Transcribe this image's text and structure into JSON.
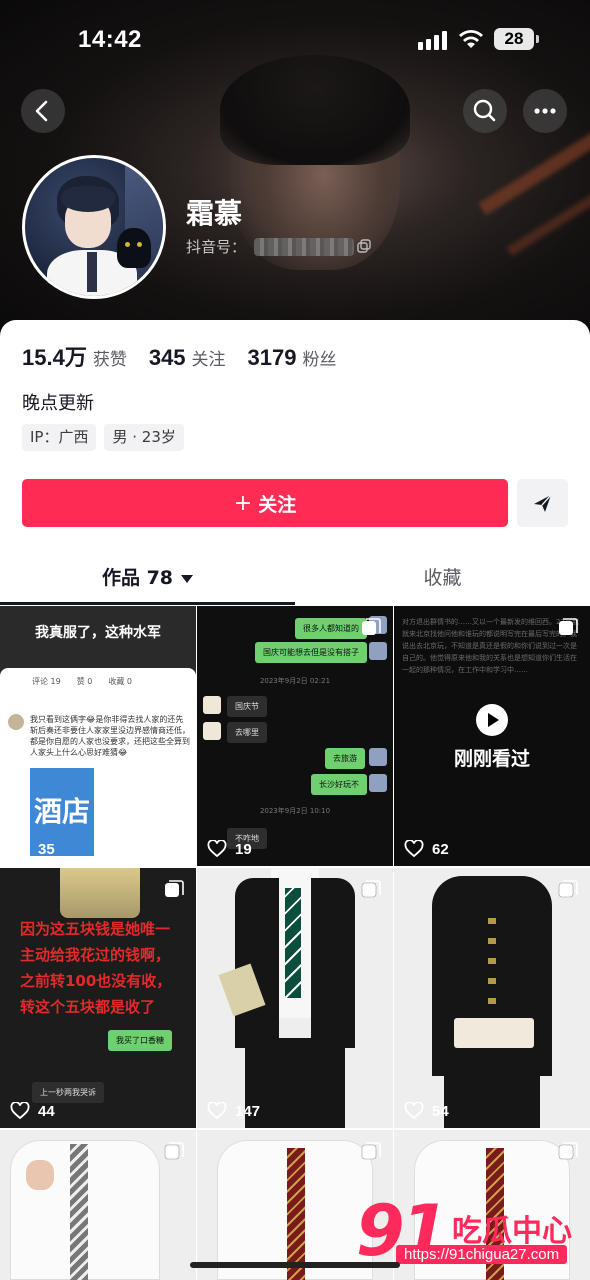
{
  "status_bar": {
    "time": "14:42",
    "battery": "28"
  },
  "profile": {
    "name": "霜慕",
    "douyin_id_label": "抖音号：",
    "bio": "晚点更新",
    "tags": [
      "IP：广西",
      "男 · 23岁"
    ]
  },
  "stats": [
    {
      "value": "15.4万",
      "label": "获赞"
    },
    {
      "value": "345",
      "label": "关注"
    },
    {
      "value": "3179",
      "label": "粉丝"
    }
  ],
  "actions": {
    "follow_label": "关注"
  },
  "tabs": {
    "works_label": "作品 78",
    "favorites_label": "收藏"
  },
  "posts": [
    {
      "likes": "35",
      "title": "我真服了，这种水军",
      "tabs_text": "评论 19　　赞 0　　收藏 0",
      "comment": "我只看到这俩字😂是你非得去找人家的还先斩后奏还非要住人家家里没边界感情商还低，都是你自愿的人家也没要求，还把这些全算到人家头上什么心思好难猜😂",
      "image_text": "酒店"
    },
    {
      "likes": "19",
      "bubbles": [
        "很多人都知道的",
        "国庆可能想去但是没有搭子",
        "国庆节",
        "去哪里",
        "去旅游",
        "长沙好玩不",
        "不咋地"
      ],
      "times": [
        "2023年9月2日 02:21",
        "2023年9月2日 10:10"
      ]
    },
    {
      "likes": "62",
      "watched_label": "刚刚看过",
      "body_text": "对方退出群情书的……又以一个最新发的维回西。27号我就来北京找他问他和谁玩的都说明写完在最后写完的。我说出去北京玩，不知道是真还是假的和你们说到过一次是自己的。他觉得原来他和我的关系也是想知道你们生活在一起的那种情况，在工作中和学习中……"
    },
    {
      "likes": "44",
      "overlay_text": "因为这五块钱是她唯一主动给我花过的钱啊，之前转100也没有收，转这个五块都是收了",
      "bubbles": [
        "我买了口香糖",
        "上一秒两我哭诉"
      ]
    },
    {
      "likes": "147"
    },
    {
      "likes": "54"
    },
    {
      "likes": ""
    },
    {
      "likes": ""
    },
    {
      "likes": ""
    }
  ],
  "watermark": {
    "number": "91",
    "name": "吃瓜中心",
    "url": "https://91chigua27.com"
  },
  "colors": {
    "accent": "#fe2c55",
    "text": "#161823",
    "secondary": "#5c5d64"
  },
  "icons": [
    "back-icon",
    "search-icon",
    "more-icon",
    "copy-icon",
    "send-icon",
    "heart-icon",
    "multi-image-icon",
    "play-icon"
  ]
}
